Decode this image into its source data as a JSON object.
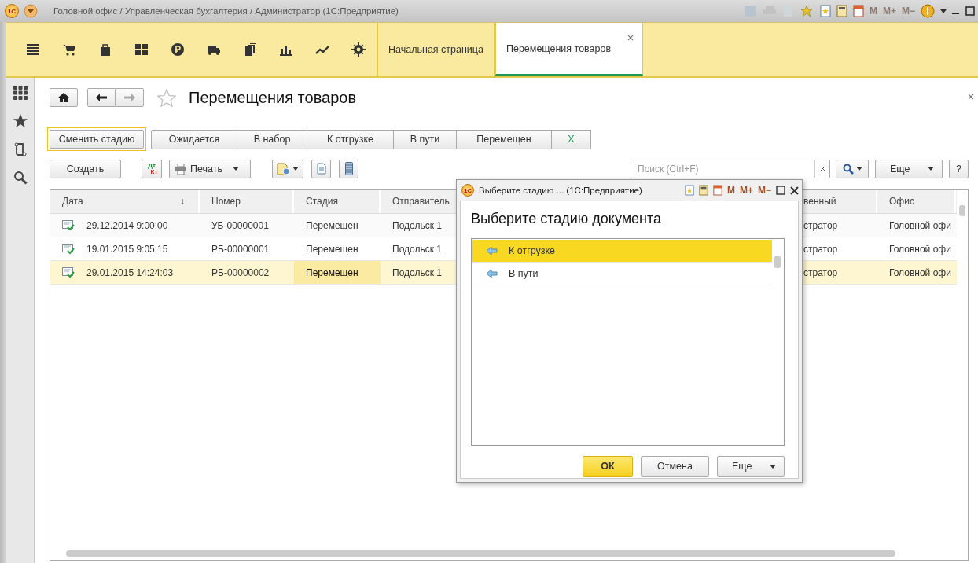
{
  "app_logo": "1С",
  "window": {
    "title": "Головной офис / Управленческая бухгалтерия / Администратор  (1С:Предприятие)",
    "memory_buttons": [
      {
        "label": "M",
        "disabled": true
      },
      {
        "label": "M+",
        "disabled": true
      },
      {
        "label": "M−",
        "disabled": true
      }
    ]
  },
  "tabs": [
    {
      "label": "Начальная страница",
      "selected": false
    },
    {
      "label": "Перемещения товаров",
      "selected": true
    }
  ],
  "page": {
    "title": "Перемещения товаров",
    "favorite": false
  },
  "stage_bar": {
    "change_button": "Сменить стадию",
    "stages": [
      {
        "label": "Ожидается",
        "kind": "stage"
      },
      {
        "label": "В набор",
        "kind": "stage"
      },
      {
        "label": "К отгрузке",
        "kind": "stage"
      },
      {
        "label": "В пути",
        "kind": "stage"
      },
      {
        "label": "Перемещен",
        "kind": "stage"
      },
      {
        "label": "X",
        "kind": "clear"
      }
    ]
  },
  "toolbar": {
    "create": "Создать",
    "dtkt": [
      "Дт",
      "Кт"
    ],
    "print": "Печать",
    "search": {
      "placeholder": "Поиск (Ctrl+F)"
    },
    "more": "Еще",
    "help": "?"
  },
  "table": {
    "columns": [
      {
        "label": "Дата",
        "sort_mark": "↓"
      },
      {
        "label": "Номер"
      },
      {
        "label": "Стадия"
      },
      {
        "label": "Отправитель"
      },
      {
        "label": "венный"
      },
      {
        "label": "Офис"
      }
    ],
    "rows": [
      {
        "cells": [
          "29.12.2014 9:00:00",
          "УБ-00000001",
          "Перемещен",
          "Подольск 1",
          "стратор",
          "Головной офи"
        ],
        "selected": false
      },
      {
        "cells": [
          "19.01.2015 9:05:15",
          "РБ-00000001",
          "Перемещен",
          "Подольск 1",
          "стратор",
          "Головной офи"
        ],
        "selected": false
      },
      {
        "cells": [
          "29.01.2015 14:24:03",
          "РБ-00000002",
          "Перемещен",
          "Подольск 1",
          "стратор",
          "Головной офи"
        ],
        "selected": true
      }
    ]
  },
  "dialog": {
    "logo": "1С",
    "title": "Выберите стадию ...  (1С:Предприятие)",
    "memory_buttons": [
      {
        "label": "M",
        "disabled": false
      },
      {
        "label": "M+",
        "disabled": false
      },
      {
        "label": "M−",
        "disabled": false
      }
    ],
    "heading": "Выберите стадию документа",
    "items": [
      {
        "label": "К отгрузке",
        "selected": true
      },
      {
        "label": "В пути",
        "selected": false
      }
    ],
    "buttons": [
      {
        "label": "ОК",
        "kind": "default"
      },
      {
        "label": "Отмена",
        "kind": "plain"
      },
      {
        "label": "Еще",
        "kind": "menu"
      }
    ]
  }
}
